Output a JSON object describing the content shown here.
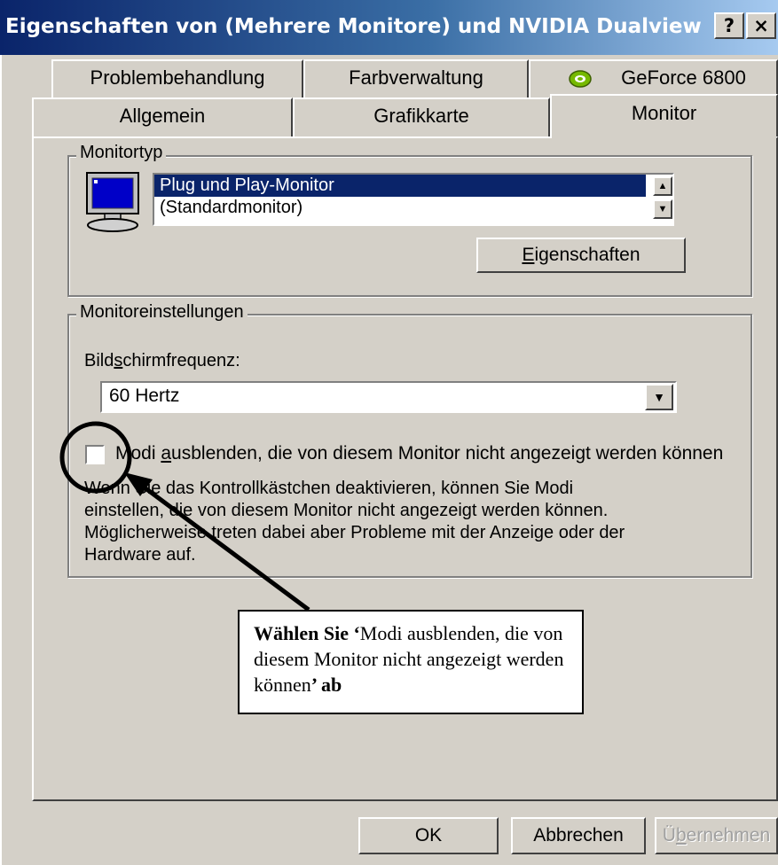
{
  "window": {
    "title": "Eigenschaften von (Mehrere Monitore) und NVIDIA Dualview",
    "help_button": "?",
    "close_button": "×"
  },
  "tabs_back": [
    "Problembehandlung",
    "Farbverwaltung",
    "GeForce 6800"
  ],
  "tabs_front": [
    "Allgemein",
    "Grafikkarte",
    "Monitor"
  ],
  "active_tab": "Monitor",
  "monitortyp": {
    "legend": "Monitortyp",
    "list_items": [
      "Plug und Play-Monitor",
      "(Standardmonitor)"
    ],
    "selected_item": "Plug und Play-Monitor",
    "properties_button": {
      "prefix": "",
      "accel": "E",
      "rest": "igenschaften"
    }
  },
  "monitoreinstellungen": {
    "legend": "Monitoreinstellungen",
    "frequency_label": {
      "prefix": "Bild",
      "accel": "s",
      "rest": "chirmfrequenz:"
    },
    "frequency_value": "60 Hertz",
    "checkbox_label": {
      "prefix": "Modi ",
      "accel": "a",
      "rest": "usblenden, die von diesem Monitor nicht angezeigt werden können"
    },
    "checkbox_checked": false,
    "description": [
      "Wenn Sie das Kontrollkästchen deaktivieren, können Sie Modi",
      "einstellen, die von diesem Monitor nicht angezeigt werden können.",
      "Möglicherweise treten dabei aber Probleme mit der Anzeige oder der",
      "Hardware auf."
    ]
  },
  "callout": {
    "bold_start": "Wählen Sie ‘",
    "text": "Modi ausblenden, die von diesem Monitor nicht angezeigt werden können",
    "bold_end": "’ ab"
  },
  "buttons": {
    "ok": "OK",
    "cancel": "Abbrechen",
    "apply": {
      "prefix": "Ü",
      "accel": "b",
      "rest": "ernehmen"
    }
  },
  "colors": {
    "title_start": "#0a246a",
    "title_end": "#a6caf0",
    "selection": "#0a246a",
    "face": "#d4d0c8"
  }
}
